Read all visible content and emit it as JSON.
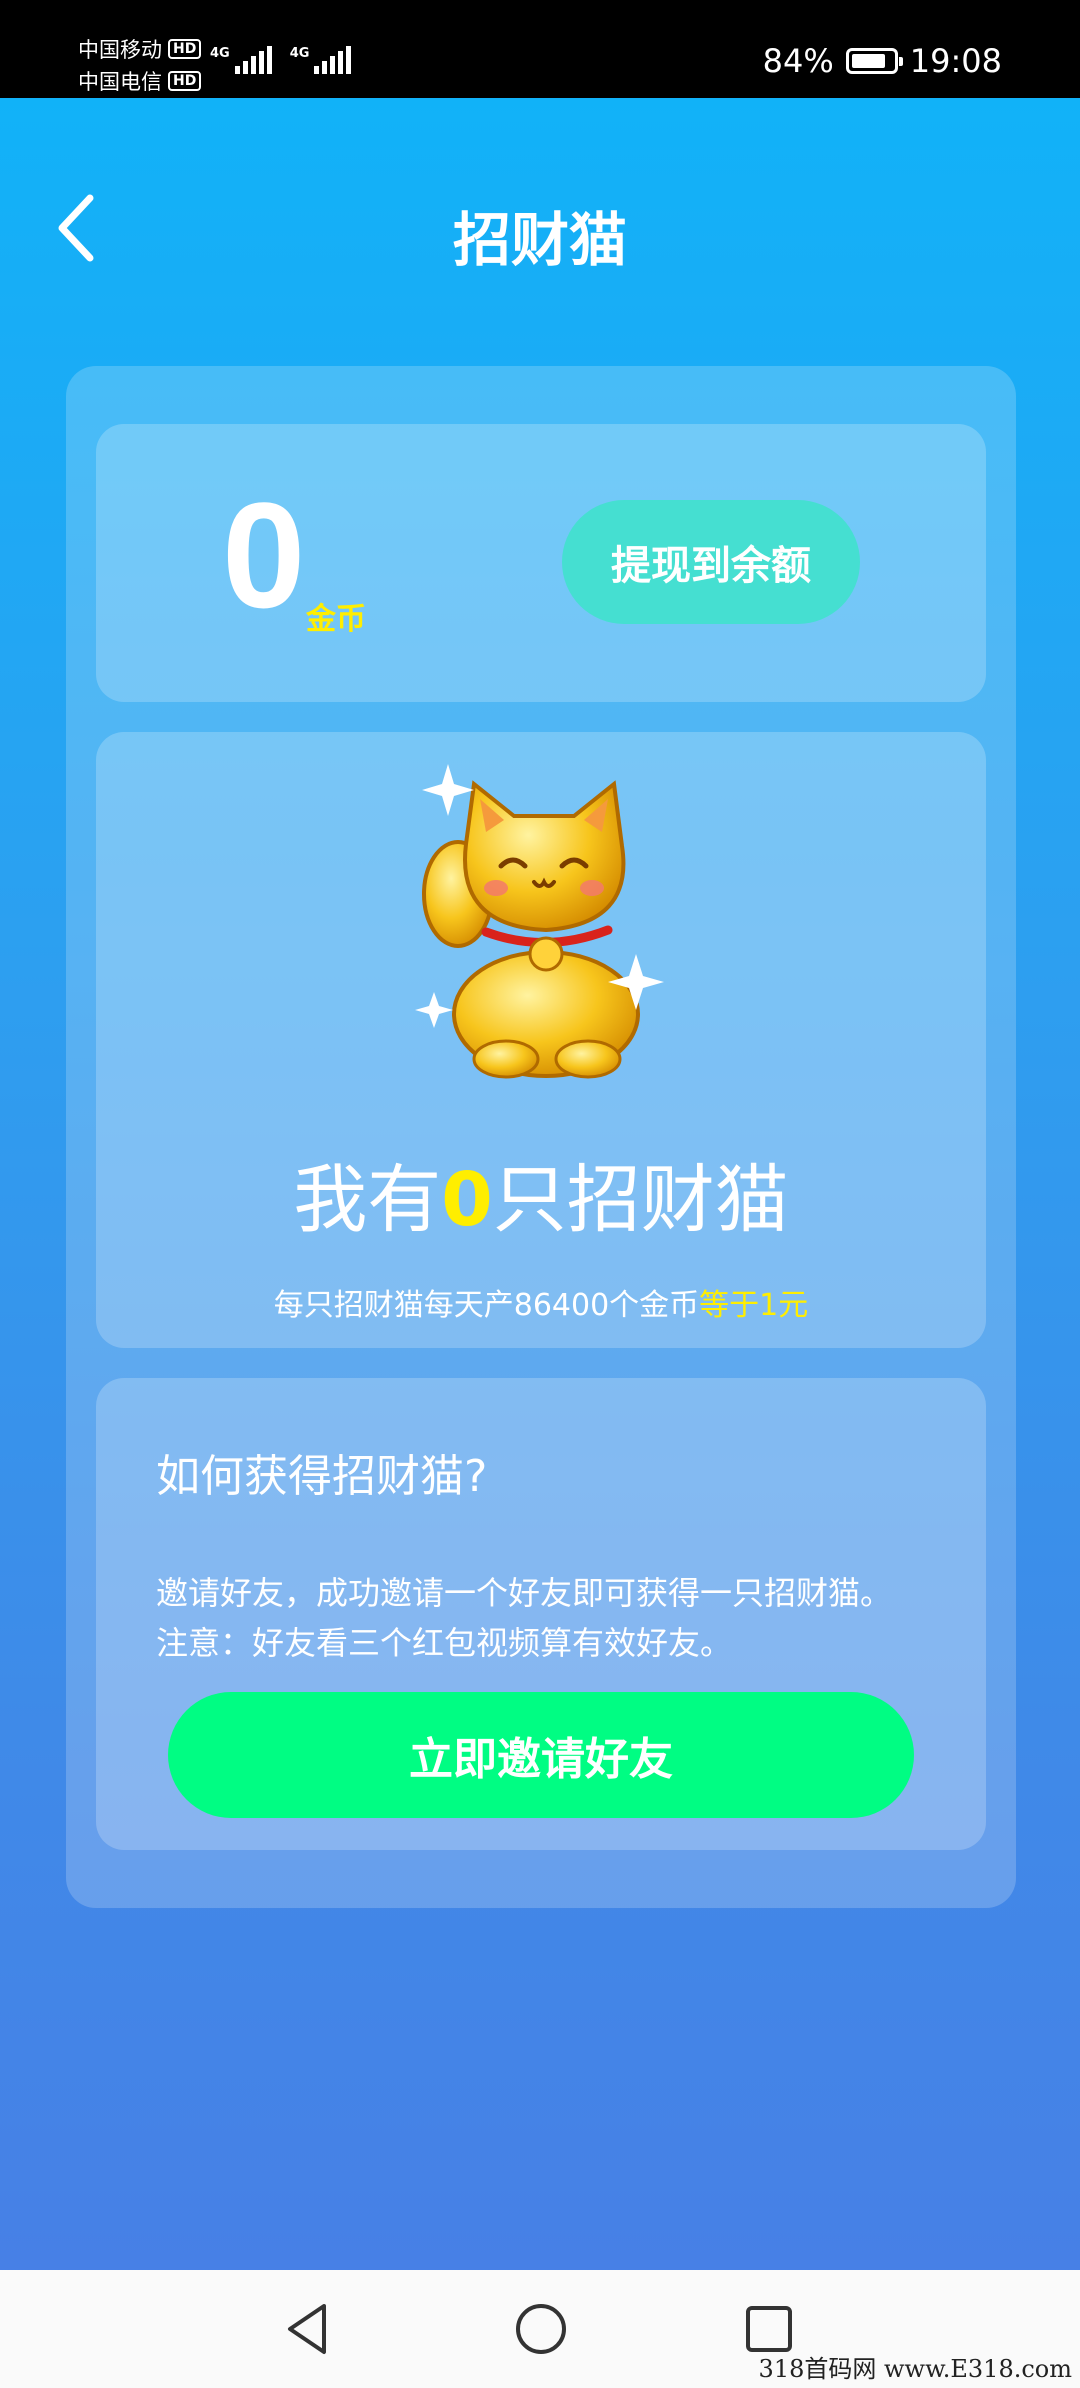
{
  "status_bar": {
    "carrier1": "中国移动",
    "carrier2": "中国电信",
    "hd": "HD",
    "network": "4G",
    "battery": "84%",
    "battery_level": 0.84,
    "time": "19:08"
  },
  "header": {
    "title": "招财猫",
    "back_icon": "chevron-left-icon"
  },
  "balance": {
    "coins": "0",
    "unit": "金币",
    "withdraw_label": "提现到余额"
  },
  "cat_section": {
    "prefix": "我有",
    "count": "0",
    "suffix": "只招财猫",
    "desc_main": "每只招财猫每天产86400个金币",
    "desc_highlight": "等于1元"
  },
  "how_section": {
    "title": "如何获得招财猫?",
    "rule1": "邀请好友，成功邀请一个好友即可获得一只招财猫。",
    "rule2": "注意：好友看三个红包视频算有效好友。",
    "invite_label": "立即邀请好友"
  },
  "nav": {
    "back": "triangle-back-icon",
    "home": "circle-home-icon",
    "recent": "square-recent-icon"
  },
  "watermark": "318首码网 www.E318.com",
  "colors": {
    "highlight": "#ffee00",
    "withdraw": "#45dfd1",
    "invite": "#00fd83"
  }
}
